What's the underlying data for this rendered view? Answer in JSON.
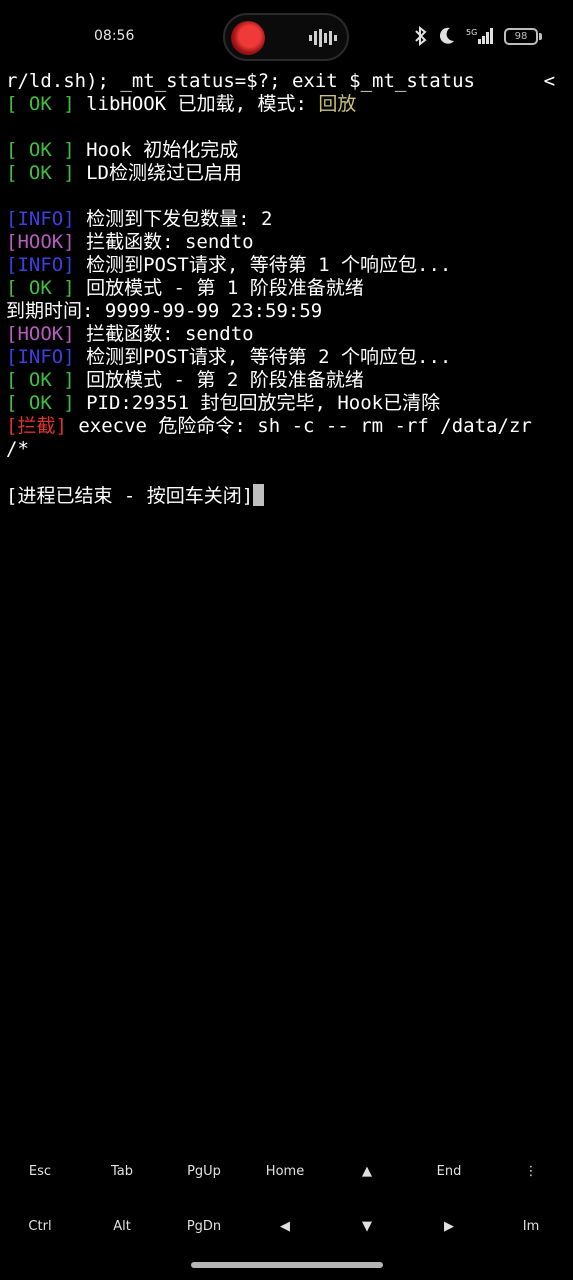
{
  "status_bar": {
    "time": "08:56",
    "network_label": "5G",
    "battery": "98",
    "icons": [
      "avatar-icon",
      "audio-wave-icon",
      "bluetooth-icon",
      "do-not-disturb-moon-icon",
      "signal-5g-icon",
      "battery-icon"
    ]
  },
  "colors": {
    "background": "#000000",
    "ok": "#3fbf3f",
    "info": "#3f3fe0",
    "hook": "#b85cc0",
    "block": "#e03131",
    "mode": "#c9c27a",
    "text": "#ffffff"
  },
  "terminal": {
    "line1": {
      "text": "r/ld.sh); _mt_status=$?; exit $_mt_status      <"
    },
    "line2": {
      "tag": "[ OK ]",
      "text": " libHOOK 已加载, 模式: ",
      "mode": "回放"
    },
    "line3": {
      "tag": "[ OK ]",
      "text": " Hook 初始化完成"
    },
    "line4": {
      "tag": "[ OK ]",
      "text": " LD检测绕过已启用"
    },
    "line5": {
      "tag": "[INFO]",
      "text": " 检测到下发包数量: 2"
    },
    "line6": {
      "tag": "[HOOK]",
      "text": " 拦截函数: sendto"
    },
    "line7": {
      "tag": "[INFO]",
      "text": " 检测到POST请求, 等待第 1 个响应包..."
    },
    "line8": {
      "tag": "[ OK ]",
      "text": " 回放模式 - 第 1 阶段准备就绪"
    },
    "line9": {
      "text": "到期时间: 9999-99-99 23:59:59"
    },
    "line10": {
      "tag": "[HOOK]",
      "text": " 拦截函数: sendto"
    },
    "line11": {
      "tag": "[INFO]",
      "text": " 检测到POST请求, 等待第 2 个响应包..."
    },
    "line12": {
      "tag": "[ OK ]",
      "text": " 回放模式 - 第 2 阶段准备就绪"
    },
    "line13": {
      "tag": "[ OK ]",
      "text": " PID:29351 封包回放完毕, Hook已清除"
    },
    "line14": {
      "tag": "[拦截]",
      "text": " execve 危险命令: sh -c -- rm -rf /data/zr"
    },
    "line15": {
      "text": "/*"
    },
    "line16": {
      "text": "[进程已结束 - 按回车关闭]"
    }
  },
  "extra_keys": {
    "row1": [
      "Esc",
      "Tab",
      "PgUp",
      "Home",
      "▲",
      "End",
      "⋮"
    ],
    "row2": [
      "Ctrl",
      "Alt",
      "PgDn",
      "◀",
      "▼",
      "▶",
      "Im"
    ]
  }
}
